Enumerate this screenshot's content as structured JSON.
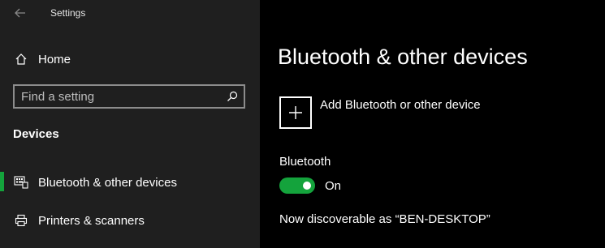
{
  "window": {
    "title": "Settings"
  },
  "sidebar": {
    "home_label": "Home",
    "search_placeholder": "Find a setting",
    "section_title": "Devices",
    "items": [
      {
        "label": "Bluetooth & other devices",
        "icon": "keyboard-icon",
        "selected": true
      },
      {
        "label": "Printers & scanners",
        "icon": "printer-icon",
        "selected": false
      }
    ]
  },
  "main": {
    "title": "Bluetooth & other devices",
    "add_device_label": "Add Bluetooth or other device",
    "bluetooth_heading": "Bluetooth",
    "bluetooth_state": "On",
    "discoverable_text": "Now discoverable as “BEN-DESKTOP”"
  },
  "colors": {
    "accent": "#14a33c",
    "sidebar_bg": "#1f1f1f",
    "main_bg": "#000000"
  }
}
